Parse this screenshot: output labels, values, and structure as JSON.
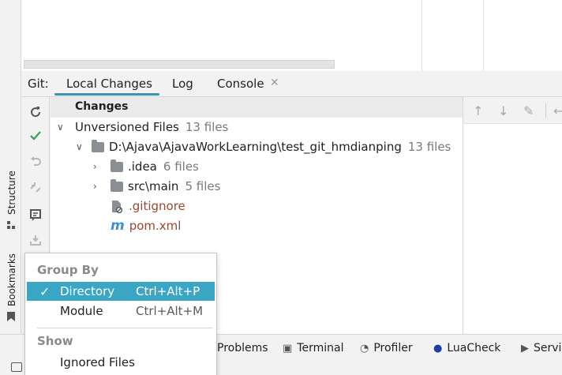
{
  "tool_window": {
    "prefix": "Git:",
    "tabs": [
      {
        "label": "Local Changes",
        "active": true
      },
      {
        "label": "Log",
        "active": false
      },
      {
        "label": "Console",
        "active": false,
        "closable": true
      }
    ]
  },
  "left_strip": {
    "structure": "Structure",
    "bookmarks": "Bookmarks"
  },
  "changes": {
    "title": "Changes",
    "unversioned": {
      "label": "Unversioned Files",
      "count": "13 files"
    },
    "root": {
      "label": "D:\\Ajava\\AjavaWorkLearning\\test_git_hmdianping",
      "count": "13 files"
    },
    "folders": [
      {
        "label": ".idea",
        "count": "6 files"
      },
      {
        "label": "src\\main",
        "count": "5 files"
      }
    ],
    "files": [
      {
        "label": ".gitignore",
        "icon": "gitignore-file-icon"
      },
      {
        "label": "pom.xml",
        "icon": "maven-icon"
      }
    ]
  },
  "popup_menu": {
    "group_by_heading": "Group By",
    "items": [
      {
        "label": "Directory",
        "shortcut": "Ctrl+Alt+P",
        "checked": true
      },
      {
        "label": "Module",
        "shortcut": "Ctrl+Alt+M",
        "checked": false
      }
    ],
    "show_heading": "Show",
    "show_items": [
      {
        "label": "Ignored Files"
      }
    ]
  },
  "bottom_bar": {
    "items": [
      "Problems",
      "Terminal",
      "Profiler",
      "LuaCheck",
      "Servi"
    ]
  },
  "colors": {
    "accent": "#3895b8",
    "selection": "#3ba6c3",
    "untracked_file": "#a0462b",
    "check_green": "#3aa65a"
  }
}
